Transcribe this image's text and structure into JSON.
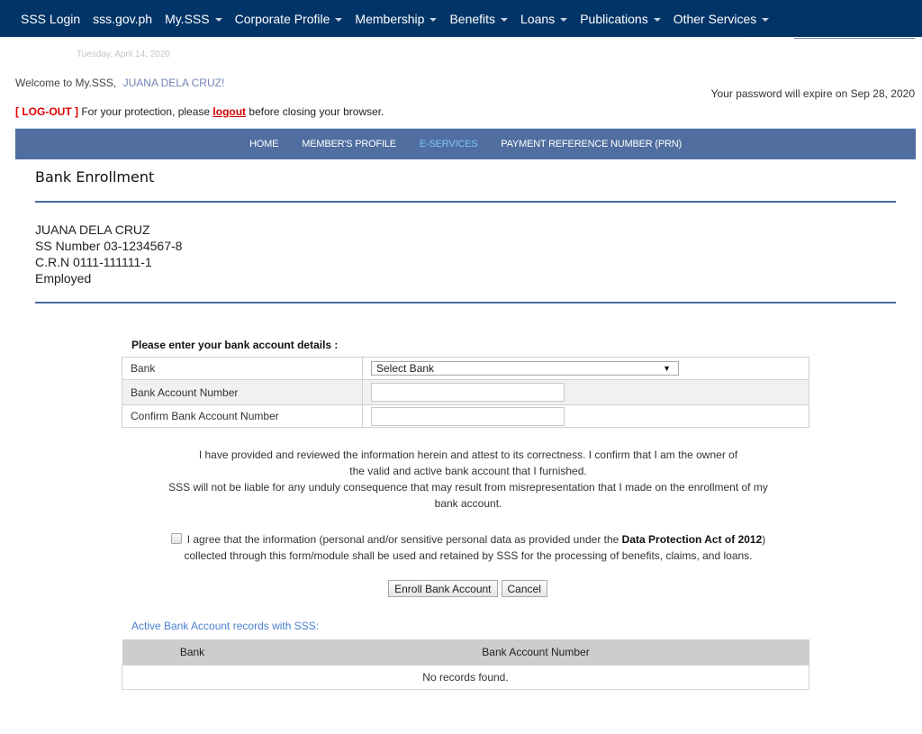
{
  "topnav": {
    "items": [
      {
        "label": "SSS Login",
        "dropdown": false
      },
      {
        "label": "sss.gov.ph",
        "dropdown": false
      },
      {
        "label": "My.SSS",
        "dropdown": true
      },
      {
        "label": "Corporate Profile",
        "dropdown": true
      },
      {
        "label": "Membership",
        "dropdown": true
      },
      {
        "label": "Benefits",
        "dropdown": true
      },
      {
        "label": "Loans",
        "dropdown": true
      },
      {
        "label": "Publications",
        "dropdown": true
      },
      {
        "label": "Other Services",
        "dropdown": true
      }
    ]
  },
  "header": {
    "date": "Tuesday, April 14, 2020",
    "welcome_prefix": "Welcome to My.SSS,",
    "user_name": "JUANA DELA CRUZ!",
    "password_expiry": "Your password will expire on Sep 28, 2020",
    "logout_tag": "[ LOG-OUT ]",
    "logout_text_before": " For your protection, please ",
    "logout_link": "logout",
    "logout_text_after": " before closing your browser."
  },
  "subnav": {
    "items": [
      {
        "label": "HOME",
        "active": false
      },
      {
        "label": "MEMBER'S PROFILE",
        "active": false
      },
      {
        "label": "E-SERVICES",
        "active": true
      },
      {
        "label": "PAYMENT REFERENCE NUMBER (PRN)",
        "active": false
      }
    ]
  },
  "page": {
    "title": "Bank Enrollment"
  },
  "member": {
    "name": "JUANA DELA CRUZ",
    "ss_number": "SS Number 03-1234567-8",
    "crn": "C.R.N 0111-111111-1",
    "status": "Employed"
  },
  "form": {
    "heading": "Please enter your bank account details :",
    "bank_label": "Bank",
    "bank_selected": "Select Bank",
    "account_label": "Bank Account Number",
    "account_value": "",
    "confirm_label": "Confirm Bank Account Number",
    "confirm_value": ""
  },
  "attestation": {
    "line1": "I have provided and reviewed the information herein and attest to its correctness. I confirm that I am the owner of",
    "line2": "the valid and active bank account that I furnished.",
    "line3": "SSS will not be liable for any unduly consequence that may result from misrepresentation that I made on the enrollment of my",
    "line4": "bank account."
  },
  "agreement": {
    "checked": false,
    "text_before": "I agree that the information (personal and/or sensitive personal data as provided under the ",
    "bold": "Data Protection Act of 2012",
    "text_after": ")",
    "line2": "collected through this form/module shall be used and retained by SSS for the processing of benefits, claims, and loans."
  },
  "buttons": {
    "enroll": "Enroll Bank Account",
    "cancel": "Cancel"
  },
  "records": {
    "title": "Active Bank Account records with SSS:",
    "columns": [
      "Bank",
      "Bank Account Number"
    ],
    "empty_message": "No records found."
  },
  "colors": {
    "topnav_bg": "#003366",
    "subnav_bg": "#516ea0",
    "active_subnav": "#7cc7f6",
    "logout_red": "#e00000",
    "records_title": "#4a7fd0"
  }
}
